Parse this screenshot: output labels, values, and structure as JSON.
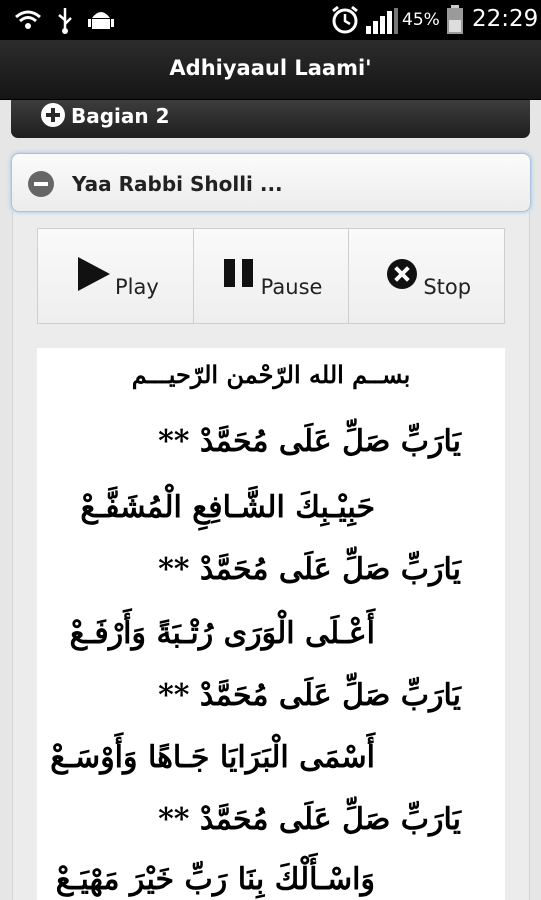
{
  "status_bar": {
    "battery": "45%",
    "time": "22:29",
    "icons": [
      "wifi-icon",
      "usb-icon",
      "android-icon",
      "alarm-icon",
      "signal-icon",
      "battery-icon"
    ]
  },
  "app": {
    "title": "Adhiyaaul Laami'"
  },
  "sections": {
    "collapsed": {
      "label": "Bagian 2"
    },
    "expanded": {
      "label": "Yaa Rabbi Sholli ..."
    }
  },
  "controls": {
    "play_label": "Play",
    "pause_label": "Pause",
    "stop_label": "Stop"
  },
  "content": {
    "basmala": "بســم الله الرّحْمن الرّحيـــم",
    "lines": [
      "يَارَبِّ صَلِّ عَلَى مُحَمَّدْ **",
      "حَبِيْـبِكَ الشَّـافِعِ الْمُشَفَّـعْ",
      "يَارَبِّ صَلِّ عَلَى مُحَمَّدْ **",
      "أَعْـلَى الْوَرَى رُتْـبَةً وَأَرْفَـعْ",
      "يَارَبِّ صَلِّ عَلَى مُحَمَّدْ **",
      "أَسْمَى الْبَرَايَا جَـاهًا وَأَوْسَـعْ",
      "يَارَبِّ صَلِّ عَلَى مُحَمَّدْ **",
      "وَاسْـأَلْكَ بِنَا رَبِّ خَيْرَ مَهْيَـعْ"
    ]
  },
  "colors": {
    "status_bar_bg": "#000000",
    "action_bar_bg": "#1f1f1f",
    "expanded_border": "#a9c2dd"
  }
}
